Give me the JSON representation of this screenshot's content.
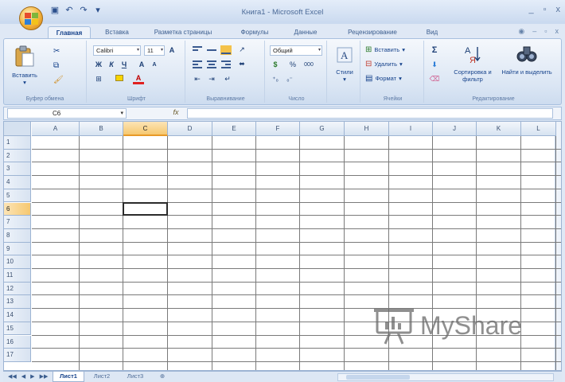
{
  "window": {
    "title": "Книга1 - Microsoft Excel",
    "controls": [
      "_",
      "▫",
      "x"
    ]
  },
  "quick_access": [
    "save-icon",
    "undo-icon",
    "redo-icon",
    "customize-icon"
  ],
  "ribbon_tabs": [
    {
      "label": "Главная",
      "active": true
    },
    {
      "label": "Вставка"
    },
    {
      "label": "Разметка страницы"
    },
    {
      "label": "Формулы"
    },
    {
      "label": "Данные"
    },
    {
      "label": "Рецензирование"
    },
    {
      "label": "Вид"
    }
  ],
  "ribbon": {
    "clipboard": {
      "paste_label": "Вставить",
      "group_label": "Буфер обмена"
    },
    "font": {
      "font_name": "Calibri",
      "font_size": "11",
      "bold": "Ж",
      "italic": "К",
      "underline": "Ч",
      "group_label": "Шрифт"
    },
    "alignment": {
      "group_label": "Выравнивание"
    },
    "number": {
      "format": "Общий",
      "percent": "%",
      "thousands": "000",
      "group_label": "Число"
    },
    "styles": {
      "label": "Стили"
    },
    "cells": {
      "insert": "Вставить",
      "delete": "Удалить",
      "format": "Формат",
      "group_label": "Ячейки"
    },
    "editing": {
      "sort_label": "Сортировка и фильтр",
      "find_label": "Найти и выделить",
      "group_label": "Редактирование"
    }
  },
  "formula_bar": {
    "name_box": "C6",
    "fx": "fx",
    "value": ""
  },
  "grid": {
    "columns": [
      "A",
      "B",
      "C",
      "D",
      "E",
      "F",
      "G",
      "H",
      "I",
      "J",
      "K",
      "L"
    ],
    "rows": [
      "1",
      "2",
      "3",
      "4",
      "5",
      "6",
      "7",
      "8",
      "9",
      "10",
      "11",
      "12",
      "13",
      "14",
      "15",
      "16",
      "17"
    ],
    "active_column": "C",
    "active_row": "6"
  },
  "sheet_tabs": [
    {
      "label": "Лист1",
      "active": true
    },
    {
      "label": "Лист2"
    },
    {
      "label": "Лист3"
    }
  ],
  "watermark": {
    "text": "MyShare"
  }
}
